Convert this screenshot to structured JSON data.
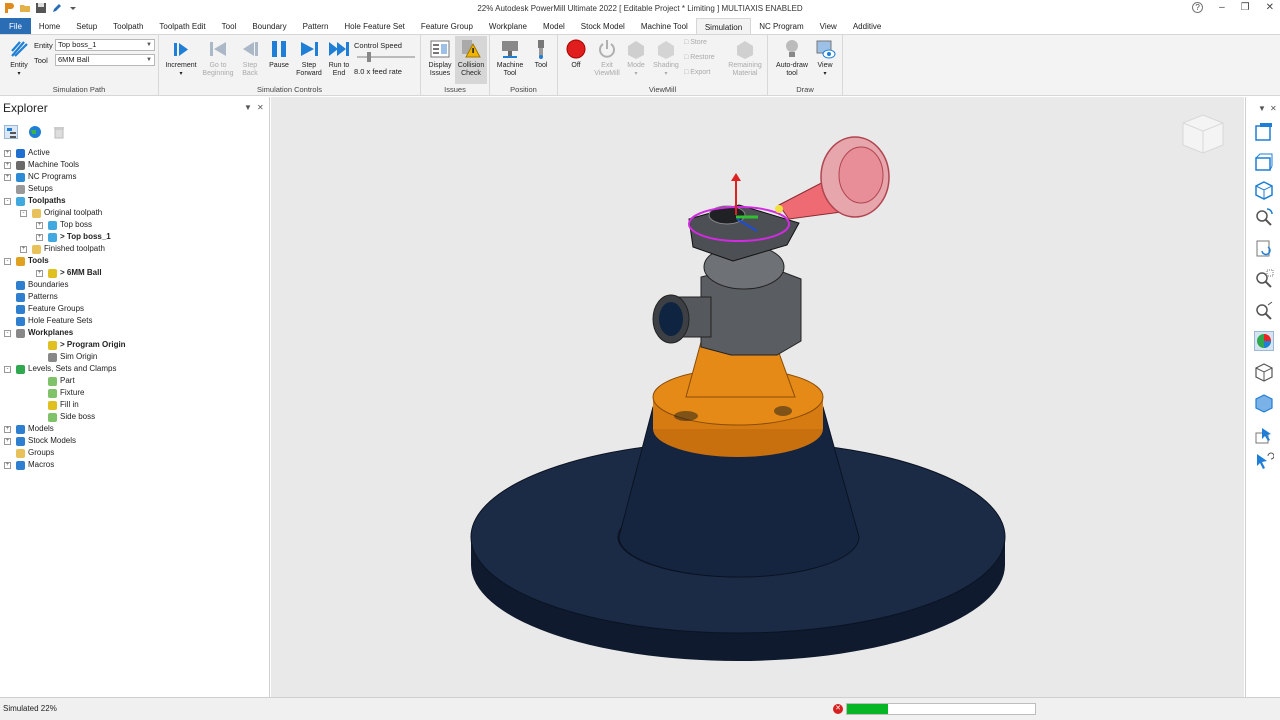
{
  "app": {
    "title": "22% Autodesk PowerMill Ultimate 2022   [ Editable Project * Limiting ]   MULTIAXIS ENABLED",
    "help_label": "?"
  },
  "tabs": [
    {
      "label": "File"
    },
    {
      "label": "Home"
    },
    {
      "label": "Setup"
    },
    {
      "label": "Toolpath"
    },
    {
      "label": "Toolpath Edit"
    },
    {
      "label": "Tool"
    },
    {
      "label": "Boundary"
    },
    {
      "label": "Pattern"
    },
    {
      "label": "Hole Feature Set"
    },
    {
      "label": "Feature Group"
    },
    {
      "label": "Workplane"
    },
    {
      "label": "Model"
    },
    {
      "label": "Stock Model"
    },
    {
      "label": "Machine Tool"
    },
    {
      "label": "Simulation"
    },
    {
      "label": "NC Program"
    },
    {
      "label": "View"
    },
    {
      "label": "Additive"
    }
  ],
  "ribbon": {
    "simulation_path": {
      "entity_btn": "Entity",
      "entity_label": "Entity",
      "entity_value": "Top boss_1",
      "tool_label": "Tool",
      "tool_value": "6MM Ball",
      "group_label": "Simulation Path"
    },
    "controls": {
      "increment": "Increment",
      "go_begin": "Go to Beginning",
      "step_back": "Step Back",
      "pause": "Pause",
      "step_forward": "Step Forward",
      "run_to_end": "Run to End",
      "speed_label": "Control Speed",
      "speed_value": "8.0 x feed rate",
      "group_label": "Simulation Controls"
    },
    "issues": {
      "display": "Display Issues",
      "collision": "Collision Check",
      "group_label": "Issues"
    },
    "position": {
      "machine_tool": "Machine Tool",
      "tool": "Tool",
      "group_label": "Position"
    },
    "viewmill": {
      "off": "Off",
      "exit": "Exit ViewMill",
      "mode": "Mode",
      "shading": "Shading",
      "store": "Store",
      "restore": "Restore",
      "export": "Export",
      "remaining": "Remaining Material",
      "group_label": "ViewMill"
    },
    "draw": {
      "auto_draw": "Auto-draw tool",
      "view": "View",
      "group_label": "Draw"
    }
  },
  "explorer": {
    "title": "Explorer",
    "tree": [
      {
        "label": "Active",
        "level": 0,
        "exp": "+",
        "bold": false,
        "icon": "#1f6fd1"
      },
      {
        "label": "Machine Tools",
        "level": 0,
        "exp": "+",
        "bold": false,
        "icon": "#6a6a6a"
      },
      {
        "label": "NC Programs",
        "level": 0,
        "exp": "+",
        "bold": false,
        "icon": "#2e8bd6"
      },
      {
        "label": "Setups",
        "level": 0,
        "exp": "",
        "bold": false,
        "icon": "#999999"
      },
      {
        "label": "Toolpaths",
        "level": 0,
        "exp": "-",
        "bold": true,
        "icon": "#41a9e0"
      },
      {
        "label": "Original toolpath",
        "level": 1,
        "exp": "-",
        "bold": false,
        "icon": "#e8c15a"
      },
      {
        "label": "Top boss",
        "level": 2,
        "exp": "+",
        "bold": false,
        "icon": "#41a9e0"
      },
      {
        "label": "> Top boss_1",
        "level": 2,
        "exp": "+",
        "bold": true,
        "icon": "#41a9e0"
      },
      {
        "label": "Finished toolpath",
        "level": 1,
        "exp": "+",
        "bold": false,
        "icon": "#e8c15a"
      },
      {
        "label": "Tools",
        "level": 0,
        "exp": "-",
        "bold": true,
        "icon": "#e0a020"
      },
      {
        "label": "> 6MM Ball",
        "level": 2,
        "exp": "+",
        "bold": true,
        "icon": "#e0c020"
      },
      {
        "label": "Boundaries",
        "level": 0,
        "exp": "",
        "bold": false,
        "icon": "#2f7fd0"
      },
      {
        "label": "Patterns",
        "level": 0,
        "exp": "",
        "bold": false,
        "icon": "#2f7fd0"
      },
      {
        "label": "Feature Groups",
        "level": 0,
        "exp": "",
        "bold": false,
        "icon": "#2f7fd0"
      },
      {
        "label": "Hole Feature Sets",
        "level": 0,
        "exp": "",
        "bold": false,
        "icon": "#2f7fd0"
      },
      {
        "label": "Workplanes",
        "level": 0,
        "exp": "-",
        "bold": true,
        "icon": "#888888"
      },
      {
        "label": "> Program Origin",
        "level": 2,
        "exp": "",
        "bold": true,
        "icon": "#e0c020"
      },
      {
        "label": "Sim Origin",
        "level": 2,
        "exp": "",
        "bold": false,
        "icon": "#888888"
      },
      {
        "label": "Levels, Sets and Clamps",
        "level": 0,
        "exp": "-",
        "bold": false,
        "icon": "#2fa84f"
      },
      {
        "label": "Part",
        "level": 2,
        "exp": "",
        "bold": false,
        "icon": "#7fc26a"
      },
      {
        "label": "Fixture",
        "level": 2,
        "exp": "",
        "bold": false,
        "icon": "#7fc26a"
      },
      {
        "label": "Fill in",
        "level": 2,
        "exp": "",
        "bold": false,
        "icon": "#e0c020"
      },
      {
        "label": "Side boss",
        "level": 2,
        "exp": "",
        "bold": false,
        "icon": "#7fc26a"
      },
      {
        "label": "Models",
        "level": 0,
        "exp": "+",
        "bold": false,
        "icon": "#2f7fd0"
      },
      {
        "label": "Stock Models",
        "level": 0,
        "exp": "+",
        "bold": false,
        "icon": "#2f7fd0"
      },
      {
        "label": "Groups",
        "level": 0,
        "exp": "",
        "bold": false,
        "icon": "#e8c15a"
      },
      {
        "label": "Macros",
        "level": 0,
        "exp": "+",
        "bold": false,
        "icon": "#2f7fd0"
      }
    ]
  },
  "status": {
    "text": "Simulated 22%",
    "progress": 0.22
  },
  "colors": {
    "accent": "#2b6db5",
    "progress": "#07b624",
    "fixture": "#e58a17",
    "table": "#1b2a45"
  }
}
